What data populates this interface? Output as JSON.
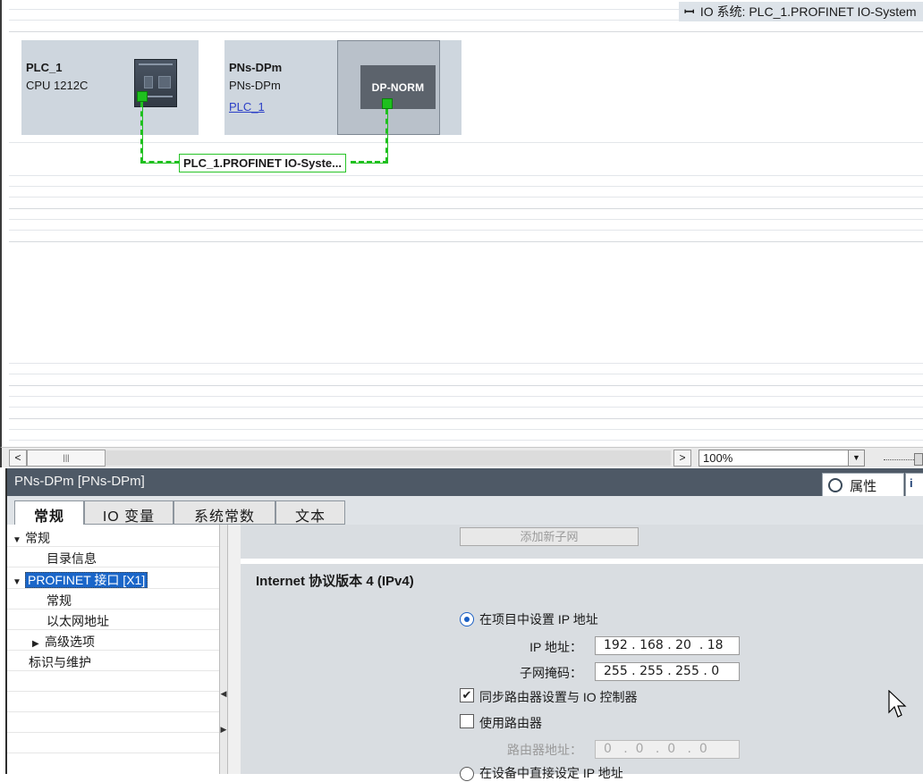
{
  "canvas": {
    "io_system_header": "IO 系统: PLC_1.PROFINET IO-System",
    "pin_glyph": "ꟷ",
    "devices": {
      "plc": {
        "name": "PLC_1",
        "type": "CPU 1212C"
      },
      "pns": {
        "name": "PNs-DPm",
        "type": "PNs-DPm",
        "link": "PLC_1",
        "module_label": "DP-NORM"
      }
    },
    "network_label": "PLC_1.PROFINET IO-Syste..."
  },
  "scrollbar": {
    "left_arrow": "<",
    "right_arrow": ">",
    "thumb_grip": "|||",
    "zoom": "100%",
    "zoom_dropdown": "▼"
  },
  "properties": {
    "title": "PNs-DPm [PNs-DPm]",
    "properties_tab": "属性",
    "info_tab": "i",
    "tabs": [
      "常规",
      "IO 变量",
      "系统常数",
      "文本"
    ],
    "tree": [
      {
        "label": "常规",
        "expander": "▼"
      },
      {
        "label": "目录信息",
        "expander": ""
      },
      {
        "label": "PROFINET 接口 [X1]",
        "expander": "▼"
      },
      {
        "label": "常规",
        "expander": ""
      },
      {
        "label": "以太网地址",
        "expander": ""
      },
      {
        "label": "高级选项",
        "expander": "▶"
      },
      {
        "label": "标识与维护",
        "expander": ""
      }
    ],
    "splitter_arrows": [
      "◀",
      "▶"
    ],
    "add_subnet_button": "添加新子网",
    "ipv4": {
      "title": "Internet 协议版本 4 (IPv4)",
      "set_in_project": "在项目中设置 IP 地址",
      "ip_label": "IP 地址：",
      "ip_value": "192 . 168 . 20  . 18",
      "mask_label": "子网掩码：",
      "mask_value": "255 . 255 . 255 . 0",
      "sync_router": "同步路由器设置与 IO 控制器",
      "sync_router_checked": true,
      "use_router": "使用路由器",
      "use_router_checked": false,
      "router_label": "路由器地址：",
      "router_value": "0   .  0   .  0   .  0",
      "set_on_device": "在设备中直接设定 IP 地址",
      "check_mark": "✔"
    }
  },
  "colors": {
    "accent_green": "#1ec01e",
    "title_bar": "#4e5966",
    "selection": "#1a66c9"
  }
}
